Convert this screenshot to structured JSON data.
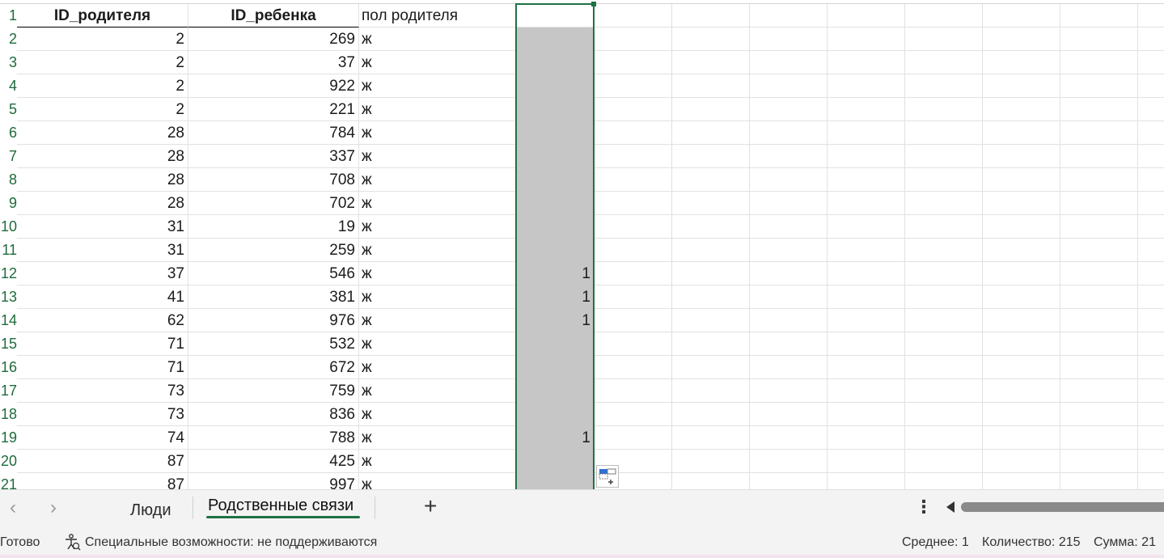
{
  "sheet": {
    "header_row": {
      "row_number": "1",
      "col_a": "ID_родителя",
      "col_b": "ID_ребенка",
      "col_c": "пол родителя",
      "col_d": ""
    },
    "rows": [
      {
        "row_number": "2",
        "parent_id": "2",
        "child_id": "269",
        "gender": "ж",
        "flag": ""
      },
      {
        "row_number": "3",
        "parent_id": "2",
        "child_id": "37",
        "gender": "ж",
        "flag": ""
      },
      {
        "row_number": "4",
        "parent_id": "2",
        "child_id": "922",
        "gender": "ж",
        "flag": ""
      },
      {
        "row_number": "5",
        "parent_id": "2",
        "child_id": "221",
        "gender": "ж",
        "flag": ""
      },
      {
        "row_number": "6",
        "parent_id": "28",
        "child_id": "784",
        "gender": "ж",
        "flag": ""
      },
      {
        "row_number": "7",
        "parent_id": "28",
        "child_id": "337",
        "gender": "ж",
        "flag": ""
      },
      {
        "row_number": "8",
        "parent_id": "28",
        "child_id": "708",
        "gender": "ж",
        "flag": ""
      },
      {
        "row_number": "9",
        "parent_id": "28",
        "child_id": "702",
        "gender": "ж",
        "flag": ""
      },
      {
        "row_number": "10",
        "parent_id": "31",
        "child_id": "19",
        "gender": "ж",
        "flag": ""
      },
      {
        "row_number": "11",
        "parent_id": "31",
        "child_id": "259",
        "gender": "ж",
        "flag": ""
      },
      {
        "row_number": "12",
        "parent_id": "37",
        "child_id": "546",
        "gender": "ж",
        "flag": "1"
      },
      {
        "row_number": "13",
        "parent_id": "41",
        "child_id": "381",
        "gender": "ж",
        "flag": "1"
      },
      {
        "row_number": "14",
        "parent_id": "62",
        "child_id": "976",
        "gender": "ж",
        "flag": "1"
      },
      {
        "row_number": "15",
        "parent_id": "71",
        "child_id": "532",
        "gender": "ж",
        "flag": ""
      },
      {
        "row_number": "16",
        "parent_id": "71",
        "child_id": "672",
        "gender": "ж",
        "flag": ""
      },
      {
        "row_number": "17",
        "parent_id": "73",
        "child_id": "759",
        "gender": "ж",
        "flag": ""
      },
      {
        "row_number": "18",
        "parent_id": "73",
        "child_id": "836",
        "gender": "ж",
        "flag": ""
      },
      {
        "row_number": "19",
        "parent_id": "74",
        "child_id": "788",
        "gender": "ж",
        "flag": "1"
      },
      {
        "row_number": "20",
        "parent_id": "87",
        "child_id": "425",
        "gender": "ж",
        "flag": ""
      },
      {
        "row_number": "21",
        "parent_id": "87",
        "child_id": "997",
        "gender": "ж",
        "flag": ""
      }
    ],
    "selection_fill_color": "#c6c6c6",
    "selection_border_color": "#1e7145"
  },
  "tabs": {
    "prev_icon": "chevron-left-icon",
    "next_icon": "chevron-right-icon",
    "items": [
      {
        "label": "Люди",
        "active": false
      },
      {
        "label": "Родственные связи",
        "active": true
      }
    ],
    "add_icon": "plus-icon",
    "more_icon": "kebab-icon"
  },
  "status": {
    "ready": "Готово",
    "accessibility": "Специальные возможности: не поддерживаются",
    "average": "Среднее: 1",
    "count": "Количество: 215",
    "sum": "Сумма: 21"
  }
}
